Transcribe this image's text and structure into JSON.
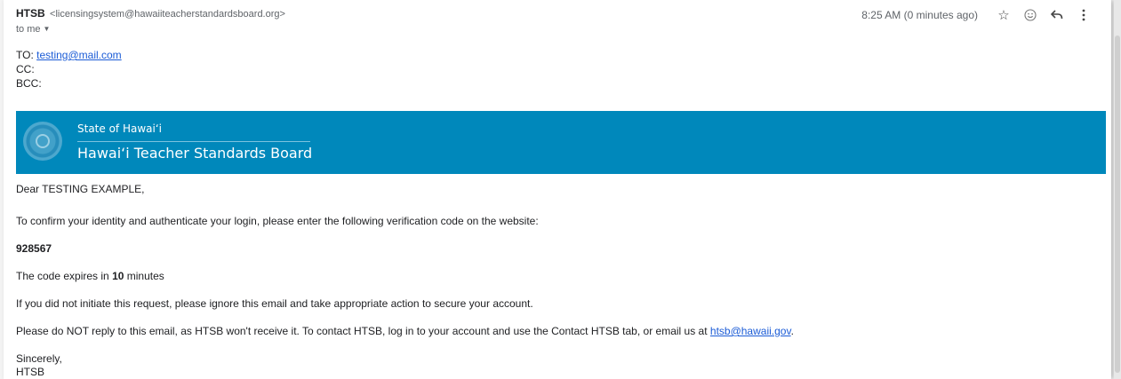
{
  "header": {
    "sender_name": "HTSB",
    "sender_email": "<licensingsystem@hawaiiteacherstandardsboard.org>",
    "to_me": "to me",
    "time": "8:25 AM (0 minutes ago)"
  },
  "icons": {
    "star": "star-icon",
    "emoji": "emoji-icon",
    "reply": "reply-icon",
    "more": "more-vert-icon"
  },
  "addresses": {
    "to_label": "TO:",
    "to_value": "testing@mail.com",
    "cc_label": "CC:",
    "bcc_label": "BCC:"
  },
  "banner": {
    "state": "State of Hawai‘i",
    "board": "Hawai‘i Teacher Standards Board",
    "color": "#0088bb"
  },
  "body": {
    "greeting": "Dear TESTING EXAMPLE,",
    "instruction": "To confirm your identity and authenticate your login, please enter the following verification code on the website:",
    "code": "928567",
    "expiry_prefix": "The code expires in ",
    "expiry_value": "10",
    "expiry_suffix": " minutes",
    "ignore_note": "If you did not initiate this request, please ignore this email and take appropriate action to secure your account.",
    "reply_note": "Please do NOT reply to this email, as HTSB won't receive it. To contact HTSB, log in to your account and use the Contact HTSB tab, or email us at ",
    "contact_email": "htsb@hawaii.gov",
    "reply_note_end": ".",
    "signoff": "Sincerely,",
    "signature": "HTSB"
  }
}
